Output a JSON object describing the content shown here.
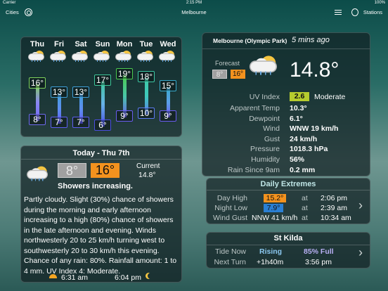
{
  "status_bar": {
    "carrier": "Carrier",
    "time": "2:15 PM",
    "battery": "100%"
  },
  "nav": {
    "cities": "Cities",
    "title": "Melbourne",
    "stations": "Stations"
  },
  "forecast": [
    {
      "day": "Thu",
      "high": "16°",
      "low": "8°",
      "high_color": "#7fd15c",
      "low_color": "#6f6af0",
      "bar_color": "#8a86f2"
    },
    {
      "day": "Fri",
      "high": "13°",
      "low": "7°",
      "high_color": "#3f9fd8",
      "low_color": "#5e5df0",
      "bar_color": "#5d8ff0"
    },
    {
      "day": "Sat",
      "high": "13°",
      "low": "7°",
      "high_color": "#3f9fd8",
      "low_color": "#5e5df0",
      "bar_color": "#5d8ff0"
    },
    {
      "day": "Sun",
      "high": "17°",
      "low": "6°",
      "high_color": "#3ec69a",
      "low_color": "#4a4de0",
      "bar_color": "#67b3e8"
    },
    {
      "day": "Mon",
      "high": "19°",
      "low": "9°",
      "high_color": "#4cc94f",
      "low_color": "#6a5cf0",
      "bar_color": "#49c7a9"
    },
    {
      "day": "Tue",
      "high": "18°",
      "low": "10°",
      "high_color": "#3ec9a6",
      "low_color": "#5c7cf0",
      "bar_color": "#3ec9bb"
    },
    {
      "day": "Wed",
      "high": "15°",
      "low": "9°",
      "high_color": "#38a9cc",
      "low_color": "#6a5cf0",
      "bar_color": "#5aa0e8"
    }
  ],
  "today": {
    "title": "Today - Thu 7th",
    "low": "8°",
    "high": "16°",
    "current_label": "Current",
    "current_value": "14.8°",
    "summary": "Showers increasing.",
    "description": "Partly cloudy. Slight (30%) chance of showers during the morning and early afternoon increasing to a high (80%) chance of showers in the late afternoon and evening. Winds northwesterly 20 to 25 km/h turning west to southwesterly 20 to 30 km/h this evening. Chance of any rain: 80%. Rainfall amount: 1 to 4 mm. UV Index 4: Moderate.",
    "sunrise": "6:31 am",
    "sunset": "6:04 pm"
  },
  "current": {
    "station": "Melbourne (Olympic Park)",
    "updated": "5 mins ago",
    "forecast_label": "Forecast",
    "forecast_low": "8°",
    "forecast_high": "16°",
    "temperature": "14.8°",
    "uv_label": "UV Index",
    "uv_value": "2.6",
    "uv_text": "Moderate",
    "uv_color": "#b6cc2e",
    "details": [
      {
        "label": "Apparent Temp",
        "value": "10.3°"
      },
      {
        "label": "Dewpoint",
        "value": "6.1°"
      },
      {
        "label": "Wind",
        "value": "WNW 19 km/h"
      },
      {
        "label": "Gust",
        "value": "24 km/h"
      },
      {
        "label": "Pressure",
        "value": "1018.3 hPa"
      },
      {
        "label": "Humidity",
        "value": "56%"
      },
      {
        "label": "Rain Since 9am",
        "value": "0.2 mm"
      }
    ]
  },
  "extremes": {
    "title": "Daily Extremes",
    "day_high_label": "Day High",
    "day_high_value": "15.2°",
    "day_high_at": "at",
    "day_high_time": "2:06 pm",
    "night_low_label": "Night Low",
    "night_low_value": "7.9°",
    "night_low_at": "at",
    "night_low_time": "2:39 am",
    "wind_gust_label": "Wind Gust",
    "wind_gust_value": "NNW 41 km/h",
    "wind_gust_at": "at",
    "wind_gust_time": "10:34 am"
  },
  "tides": {
    "title": "St Kilda",
    "tide_now_label": "Tide Now",
    "tide_now_value": "Rising",
    "tide_percent": "85% Full",
    "next_turn_label": "Next Turn",
    "next_turn_value": "+1h40m",
    "next_turn_time": "3:56 pm"
  }
}
